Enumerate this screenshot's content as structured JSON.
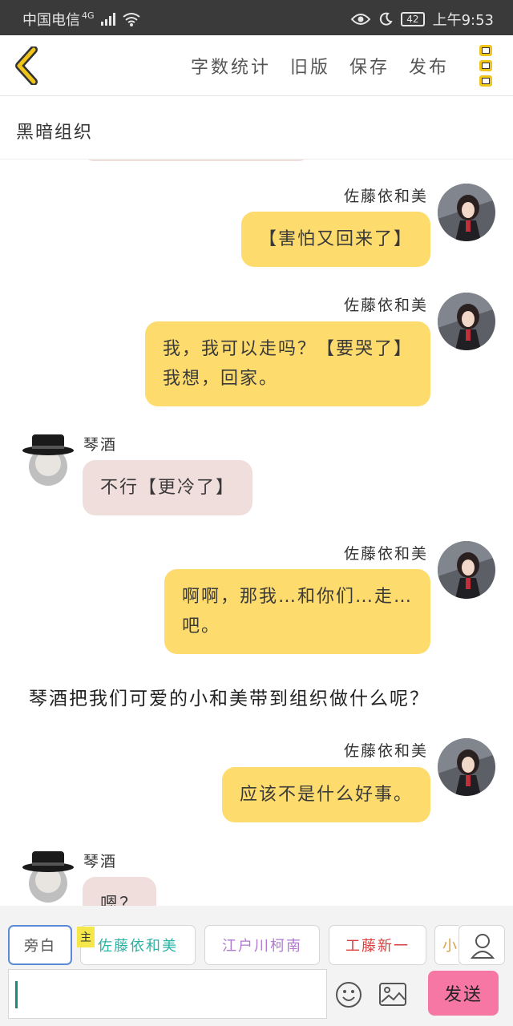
{
  "status_bar": {
    "carrier": "中国电信",
    "network": "4G",
    "battery": "42",
    "time": "上午9:53"
  },
  "toolbar": {
    "actions": [
      "字数统计",
      "旧版",
      "保存",
      "发布"
    ]
  },
  "title": "黑暗组织",
  "messages": [
    {
      "speaker": "佐藤依和美",
      "side": "right",
      "lines": [
        "【害怕又回来了】"
      ]
    },
    {
      "speaker": "佐藤依和美",
      "side": "right",
      "lines": [
        "我，我可以走吗？【要哭了】",
        "我想，回家。"
      ]
    },
    {
      "speaker": "琴酒",
      "side": "left",
      "lines": [
        "不行【更冷了】"
      ]
    },
    {
      "speaker": "佐藤依和美",
      "side": "right",
      "lines": [
        "啊啊，那我…和你们…走…",
        "吧。"
      ]
    },
    {
      "narration": "琴酒把我们可爱的小和美带到组织做什么呢？"
    },
    {
      "speaker": "佐藤依和美",
      "side": "right",
      "lines": [
        "应该不是什么好事。"
      ]
    },
    {
      "speaker": "琴酒",
      "side": "left",
      "lines": [
        "嗯？"
      ]
    }
  ],
  "role_bar": {
    "roles": [
      "旁白",
      "佐藤依和美",
      "江户川柯南",
      "工藤新一",
      "小"
    ],
    "main_tag": "主"
  },
  "input": {
    "value": ""
  },
  "send_label": "发送",
  "colors": {
    "my_bubble": "#fddb6d",
    "other_bubble": "#f0dedd",
    "send_button": "#f777a4",
    "accent": "#f0c419"
  }
}
